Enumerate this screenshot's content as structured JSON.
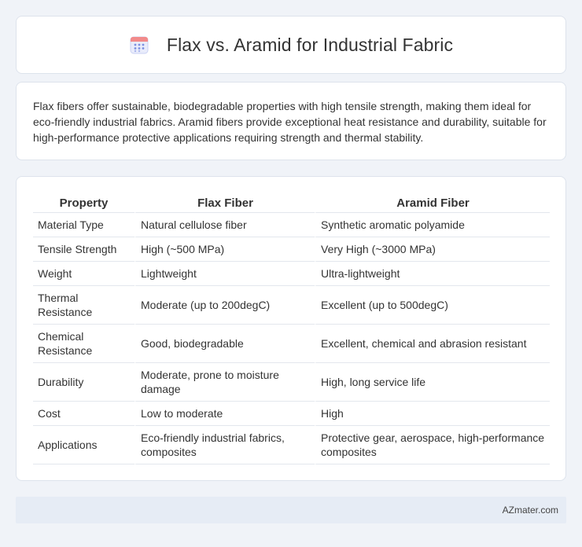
{
  "header": {
    "title": "Flax vs. Aramid for Industrial Fabric",
    "icon": "calendar-icon"
  },
  "intro": {
    "text": "Flax fibers offer sustainable, biodegradable properties with high tensile strength, making them ideal for eco-friendly industrial fabrics. Aramid fibers provide exceptional heat resistance and durability, suitable for high-performance protective applications requiring strength and thermal stability."
  },
  "table": {
    "headers": [
      "Property",
      "Flax Fiber",
      "Aramid Fiber"
    ],
    "rows": [
      [
        "Material Type",
        "Natural cellulose fiber",
        "Synthetic aromatic polyamide"
      ],
      [
        "Tensile Strength",
        "High (~500 MPa)",
        "Very High (~3000 MPa)"
      ],
      [
        "Weight",
        "Lightweight",
        "Ultra-lightweight"
      ],
      [
        "Thermal Resistance",
        "Moderate (up to 200degC)",
        "Excellent (up to 500degC)"
      ],
      [
        "Chemical Resistance",
        "Good, biodegradable",
        "Excellent, chemical and abrasion resistant"
      ],
      [
        "Durability",
        "Moderate, prone to moisture damage",
        "High, long service life"
      ],
      [
        "Cost",
        "Low to moderate",
        "High"
      ],
      [
        "Applications",
        "Eco-friendly industrial fabrics, composites",
        "Protective gear, aerospace, high-performance composites"
      ]
    ]
  },
  "footer": {
    "text": "AZmater.com"
  },
  "colors": {
    "page_bg": "#f0f3f8",
    "card_bg": "#ffffff",
    "footer_bg": "#e6ecf5",
    "icon_accent": "#7b8fe0",
    "icon_header": "#f28a8a"
  }
}
